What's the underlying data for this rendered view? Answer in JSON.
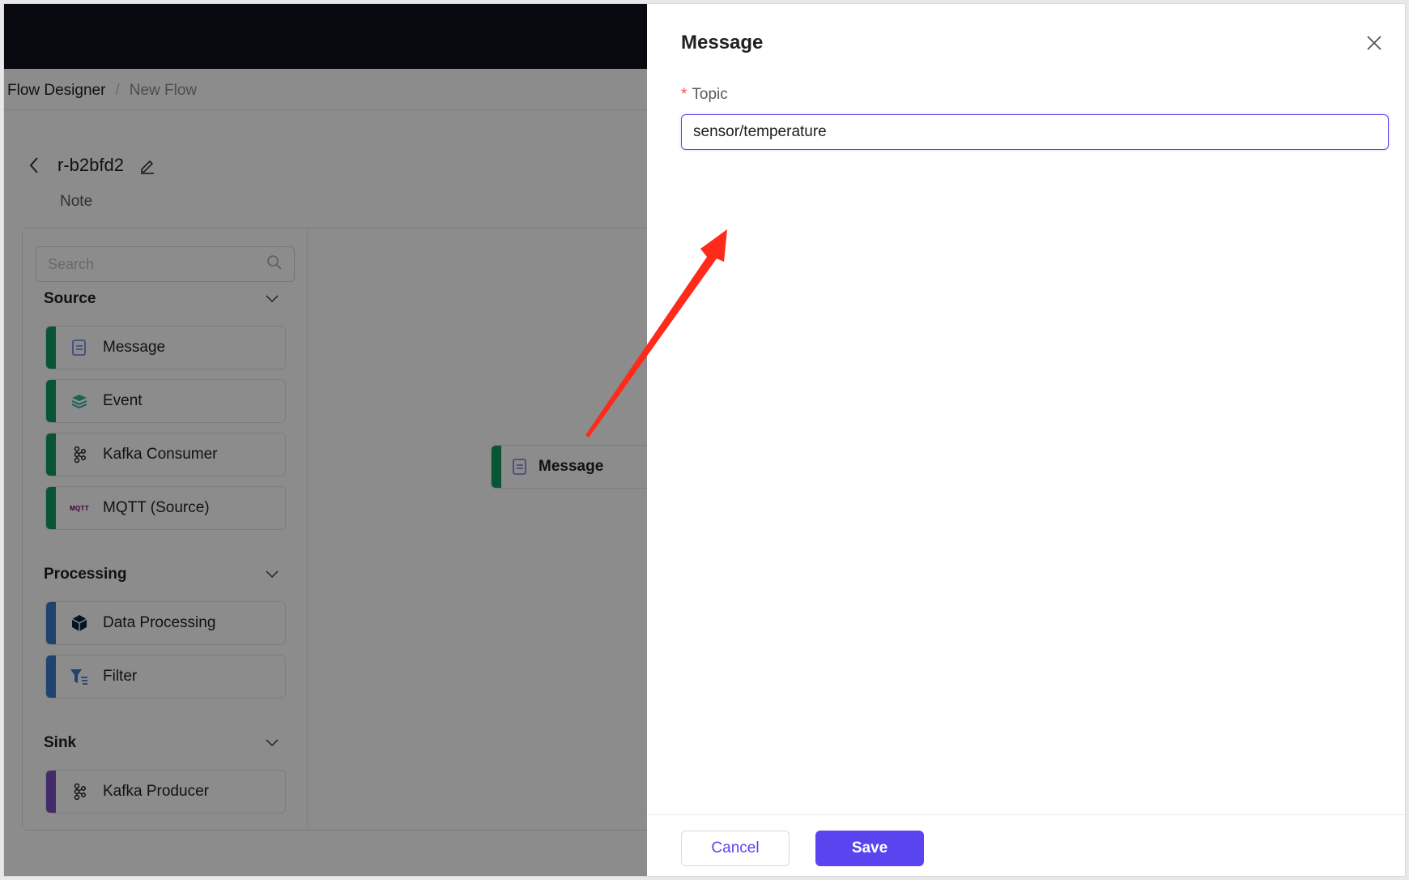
{
  "breadcrumb": {
    "root": "Flow Designer",
    "separator": "/",
    "current": "New Flow"
  },
  "flow": {
    "name": "r-b2bfd2",
    "note": "Note"
  },
  "palette": {
    "search_placeholder": "Search",
    "sections": [
      {
        "title": "Source",
        "items": [
          {
            "label": "Message",
            "icon": "message-icon"
          },
          {
            "label": "Event",
            "icon": "event-layers-icon"
          },
          {
            "label": "Kafka Consumer",
            "icon": "kafka-icon"
          },
          {
            "label": "MQTT (Source)",
            "icon": "mqtt-logo",
            "icon_text": "MQTT"
          }
        ]
      },
      {
        "title": "Processing",
        "items": [
          {
            "label": "Data Processing",
            "icon": "cube-icon"
          },
          {
            "label": "Filter",
            "icon": "filter-icon"
          }
        ]
      },
      {
        "title": "Sink",
        "items": [
          {
            "label": "Kafka Producer",
            "icon": "kafka-icon"
          }
        ]
      }
    ]
  },
  "canvas": {
    "node_label": "Message"
  },
  "drawer": {
    "title": "Message",
    "topic_label": "Topic",
    "required_mark": "*",
    "topic_value": "sensor/temperature",
    "cancel_label": "Cancel",
    "save_label": "Save"
  },
  "colors": {
    "accent": "#5a44f0",
    "source_bar": "#0f9960",
    "processing_bar": "#3b78c9",
    "sink_bar": "#7b4fc4",
    "topbar": "#0f131e",
    "annotation_arrow": "#ff2a1a"
  }
}
